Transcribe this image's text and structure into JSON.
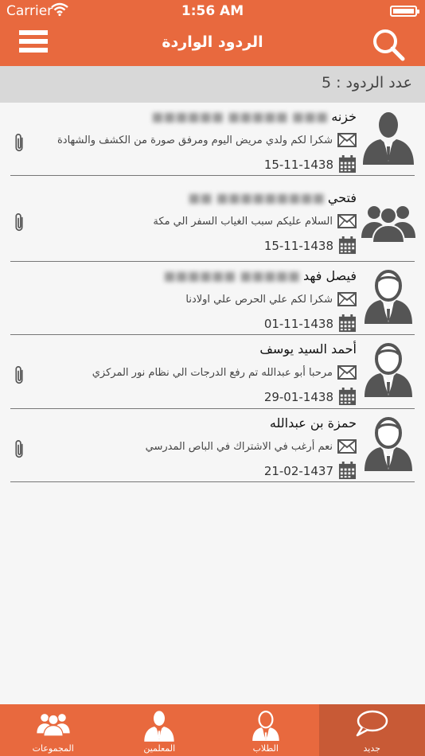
{
  "status": {
    "carrier": "Carrier",
    "time": "1:56 AM"
  },
  "nav": {
    "title": "الردود الواردة"
  },
  "count": {
    "label": "عدد الردود : 5"
  },
  "items": [
    {
      "name": "خزنه",
      "name_blur": "■■■ ■■■■■ ■■■■■■",
      "msg": "شكرا لكم ولدي مريض اليوم ومرفق صورة من الكشف والشهادة",
      "date": "15-11-1438",
      "avatar": "male-suit",
      "attach": true
    },
    {
      "name": "فتحي",
      "name_blur": "■■■■■■■■■ ■■",
      "msg": "السلام عليكم سبب الغياب السفر الي مكة",
      "date": "15-11-1438",
      "avatar": "group",
      "attach": true
    },
    {
      "name": "فيصل فهد",
      "name_blur": "■■■■■ ■■■■■■",
      "msg": "شكرا لكم علي الحرص علي اولادنا",
      "date": "01-11-1438",
      "avatar": "male-outline",
      "attach": false
    },
    {
      "name": "أحمد السيد يوسف",
      "name_blur": "",
      "msg": "مرحبا أبو عبدالله تم رفع الدرجات الي نظام نور المركزي",
      "date": "29-01-1438",
      "avatar": "male-outline",
      "attach": true
    },
    {
      "name": "حمزة بن عبدالله",
      "name_blur": "",
      "msg": "نعم أرغب في الاشتراك في الباص المدرسي",
      "date": "21-02-1437",
      "avatar": "male-outline",
      "attach": true
    }
  ],
  "tabs": [
    {
      "label": "المجموعات",
      "icon": "group-icon"
    },
    {
      "label": "المعلمين",
      "icon": "teacher-icon"
    },
    {
      "label": "الطلاب",
      "icon": "student-icon"
    },
    {
      "label": "جديد",
      "icon": "chat-bubble-icon"
    }
  ],
  "colors": {
    "primary": "#e8693e",
    "active_tab": "#c85a36",
    "count_bar": "#d8d8d8",
    "icon_gray": "#555555"
  }
}
